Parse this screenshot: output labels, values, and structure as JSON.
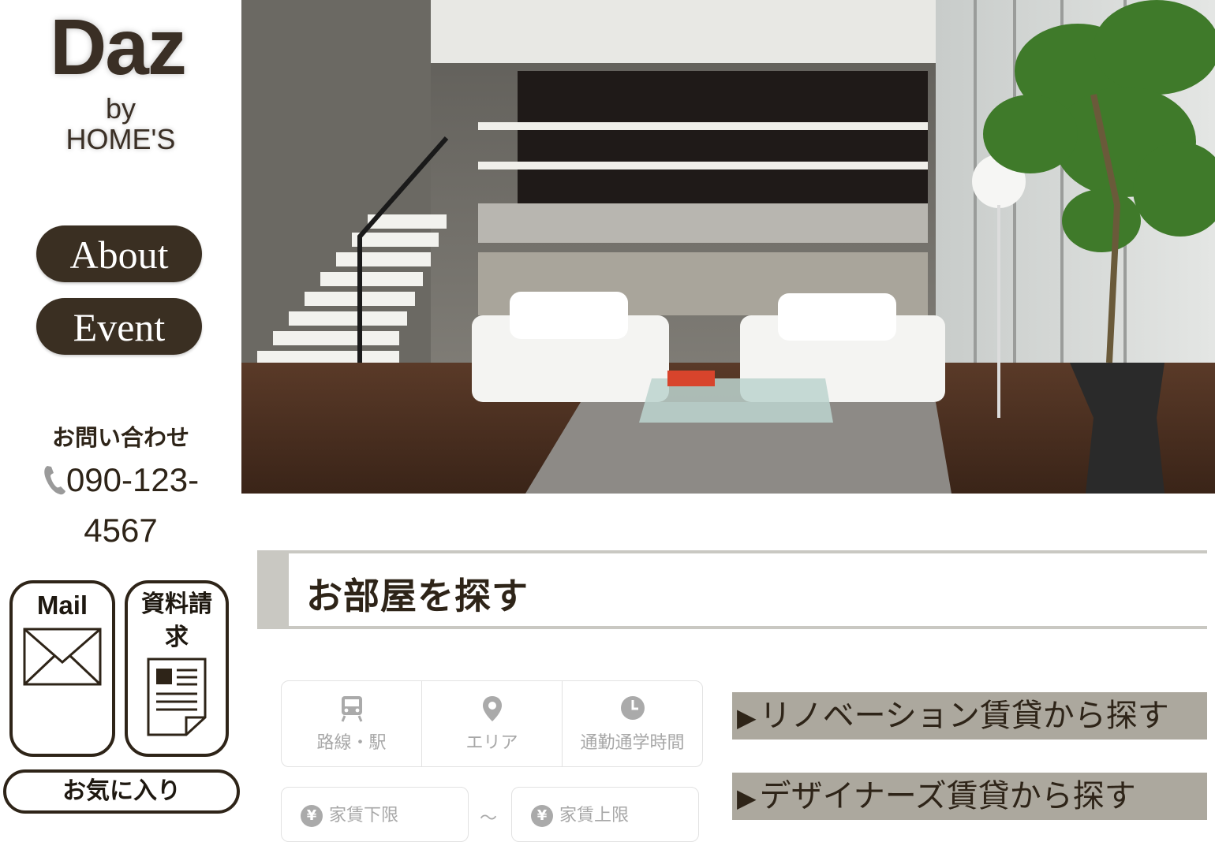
{
  "sidebar": {
    "logo": {
      "main": "Daz",
      "by": "by",
      "sub": "HOME'S"
    },
    "nav": [
      {
        "label": "About"
      },
      {
        "label": "Event"
      }
    ],
    "contact": {
      "label": "お問い合わせ",
      "phone_line1": "090-123-",
      "phone_line2": "4567",
      "icon": "phone-icon"
    },
    "cards": [
      {
        "label": "Mail",
        "icon": "envelope-icon"
      },
      {
        "label_line1": "資料請",
        "label_line2": "求",
        "icon": "document-icon"
      }
    ],
    "favorite": {
      "label": "お気に入り"
    }
  },
  "hero": {
    "icon": "living-room-photo"
  },
  "search": {
    "title": "お部屋を探す",
    "tabs": [
      {
        "label": "路線・駅",
        "icon": "train-icon"
      },
      {
        "label": "エリア",
        "icon": "map-pin-icon"
      },
      {
        "label": "通勤通学時間",
        "icon": "clock-icon"
      }
    ],
    "rent_min": {
      "label": "家賃下限",
      "icon": "yen-icon"
    },
    "rent_separator": "〜",
    "rent_max": {
      "label": "家賃上限",
      "icon": "yen-icon"
    }
  },
  "links": [
    {
      "marker": "▶",
      "label": "リノベーション賃貸から探す"
    },
    {
      "marker": "▶",
      "label": "デザイナーズ賃貸から探す"
    }
  ],
  "colors": {
    "brand_dark": "#3a2f22",
    "heading_bar": "#c9c8c2",
    "link_bar": "#aca89e",
    "muted_text": "#a7a7a7"
  }
}
